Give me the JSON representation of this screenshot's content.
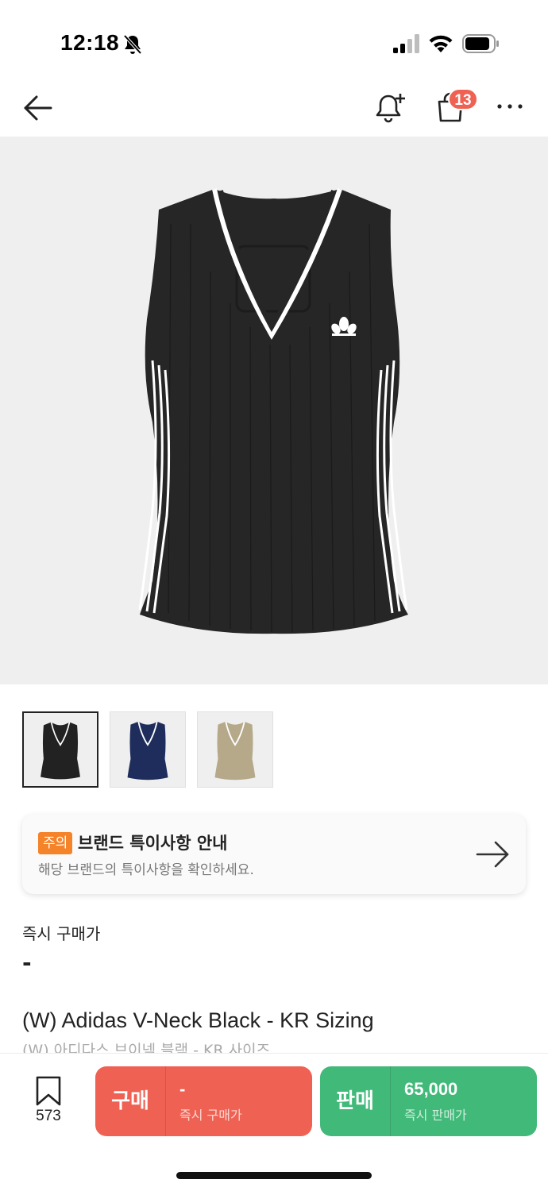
{
  "status_bar": {
    "time": "12:18",
    "icons": [
      "bell-muted-icon",
      "signal-icon",
      "wifi-icon",
      "battery-icon"
    ]
  },
  "nav": {
    "back_icon": "arrow-left-icon",
    "alert_icon": "bell-plus-icon",
    "cart_icon": "shopping-bag-icon",
    "cart_badge": "13",
    "more_icon": "more-horizontal-icon"
  },
  "product_images": {
    "thumbnails": [
      {
        "color": "#1f1f1f",
        "selected": true
      },
      {
        "color": "#1e2d5c",
        "selected": false
      },
      {
        "color": "#b5a98a",
        "selected": false
      }
    ]
  },
  "notice": {
    "tag": "주의",
    "title": "브랜드 특이사항 안내",
    "subtitle": "해당 브랜드의 특이사항을 확인하세요.",
    "arrow_icon": "arrow-right-icon"
  },
  "price": {
    "label": "즉시 구매가",
    "value": "-"
  },
  "product": {
    "name_en": "(W) Adidas V-Neck Black - KR Sizing",
    "name_ko": "(W) 아디다스 브이넥 블랙 - KR 사이즈"
  },
  "bottom_bar": {
    "wish_icon": "bookmark-icon",
    "wish_count": "573",
    "buy": {
      "label": "구매",
      "price": "-",
      "sub": "즉시 구매가",
      "color": "#ef6253"
    },
    "sell": {
      "label": "판매",
      "price": "65,000",
      "sub": "즉시 판매가",
      "color": "#41b979"
    }
  }
}
